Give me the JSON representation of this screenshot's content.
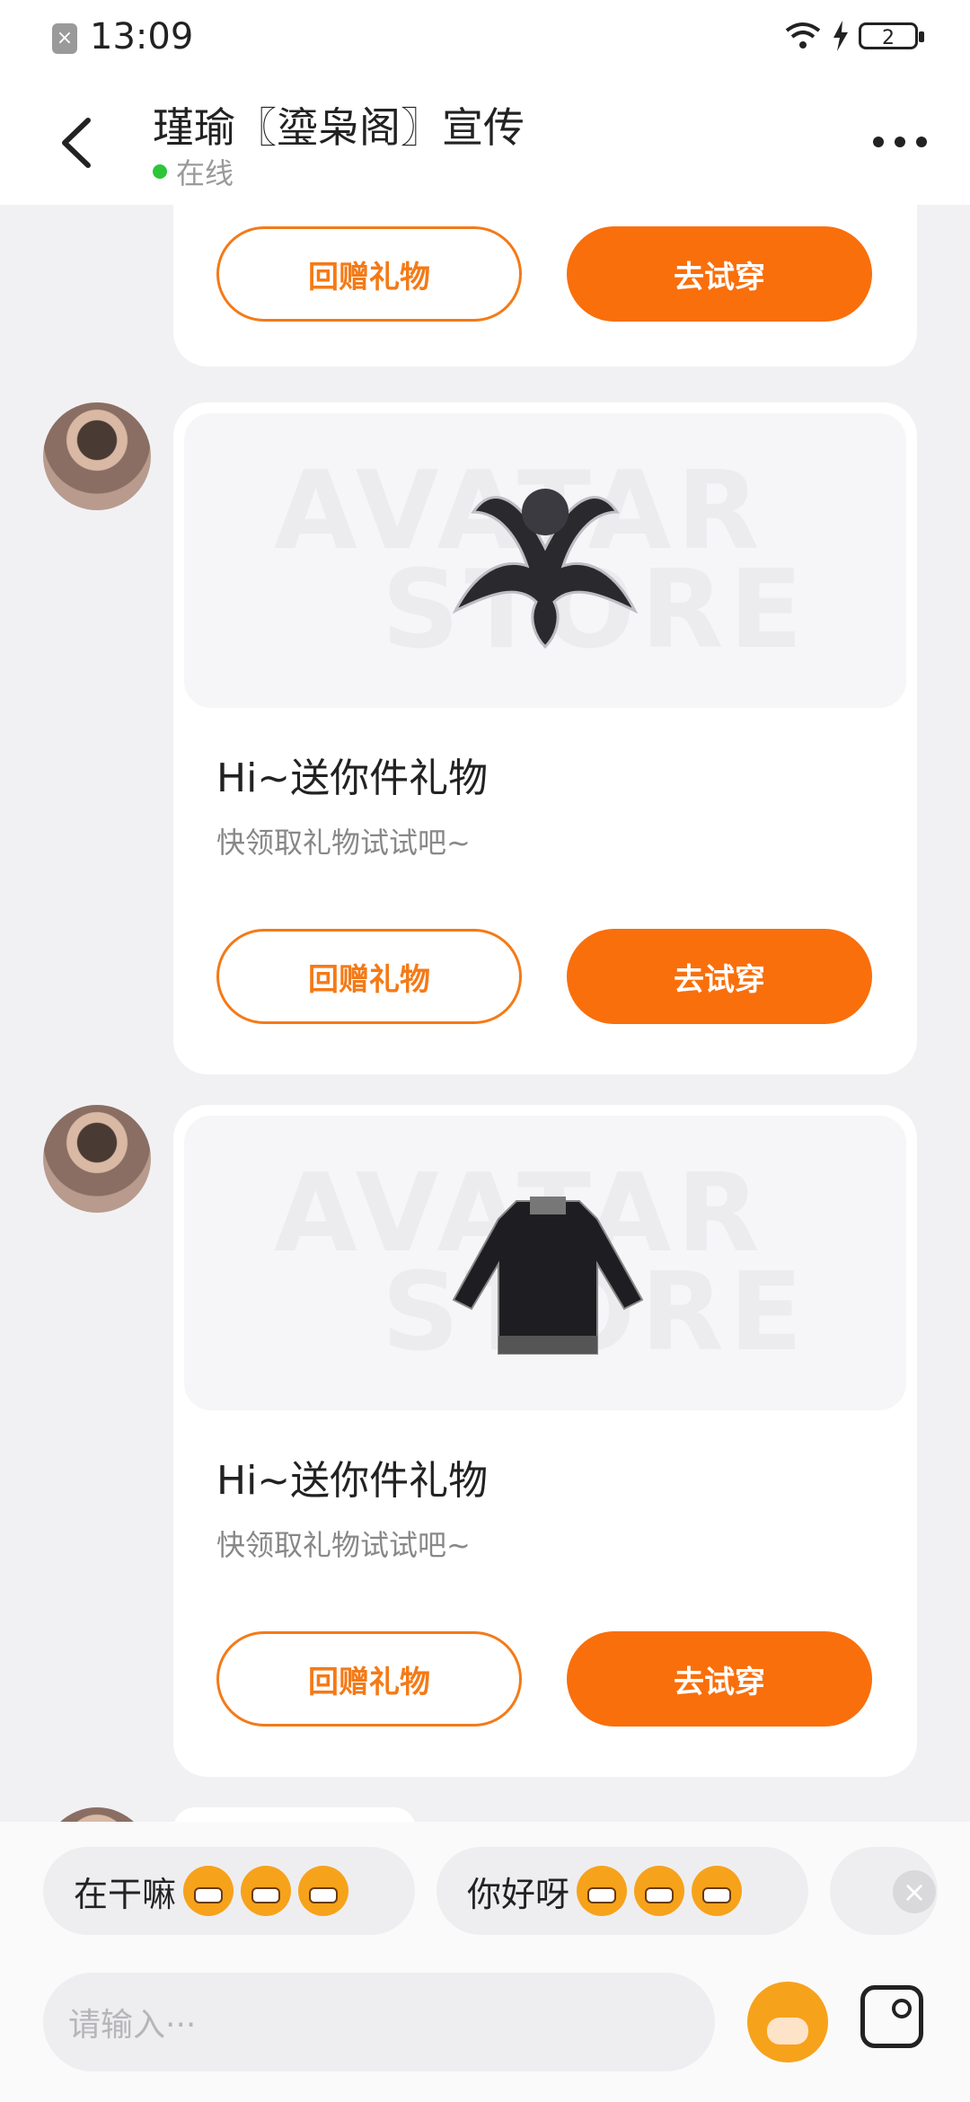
{
  "status_bar": {
    "time": "13:09",
    "battery": "2"
  },
  "header": {
    "title": "瑾瑜〖瑬枭阁〗宣传",
    "status": "在线"
  },
  "messages": [
    {
      "button_return": "回赠礼物",
      "button_try": "去试穿"
    },
    {
      "watermark_top": "AVATAR",
      "watermark_bottom": "STORE",
      "title": "Hi~送你件礼物",
      "subtitle": "快领取礼物试试吧~",
      "button_return": "回赠礼物",
      "button_try": "去试穿"
    },
    {
      "watermark_top": "AVATAR",
      "watermark_bottom": "STORE",
      "title": "Hi~送你件礼物",
      "subtitle": "快领取礼物试试吧~",
      "button_return": "回赠礼物",
      "button_try": "去试穿"
    }
  ],
  "quick_replies": [
    "在干嘛",
    "你好呀"
  ],
  "input": {
    "placeholder": "请输入···"
  },
  "colors": {
    "accent": "#f96f0c",
    "online": "#2bc63a"
  }
}
